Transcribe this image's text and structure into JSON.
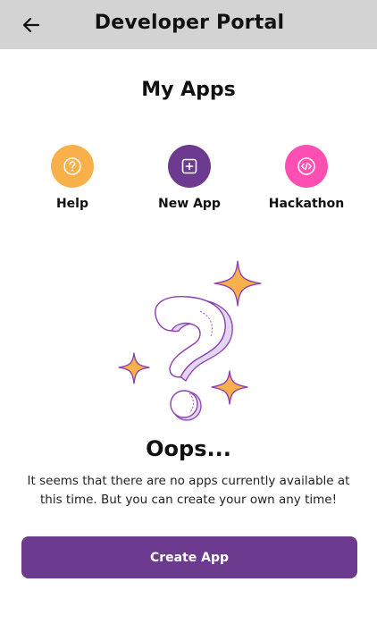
{
  "header": {
    "title": "Developer Portal",
    "back_icon": "arrow-left-icon"
  },
  "page": {
    "heading": "My Apps"
  },
  "actions": [
    {
      "label": "Help",
      "icon": "question-circle-icon",
      "color": "#f8b04a"
    },
    {
      "label": "New App",
      "icon": "plus-square-icon",
      "color": "#6c3a8e"
    },
    {
      "label": "Hackathon",
      "icon": "code-circle-icon",
      "color": "#ff4fb3"
    }
  ],
  "empty_state": {
    "illustration": "question-mark-sparkles-illustration",
    "title": "Oops...",
    "message": "It seems that there are no apps currently available at this time. But you can create your own any time!"
  },
  "create_button": {
    "label": "Create App",
    "color": "#6c3a8e"
  }
}
